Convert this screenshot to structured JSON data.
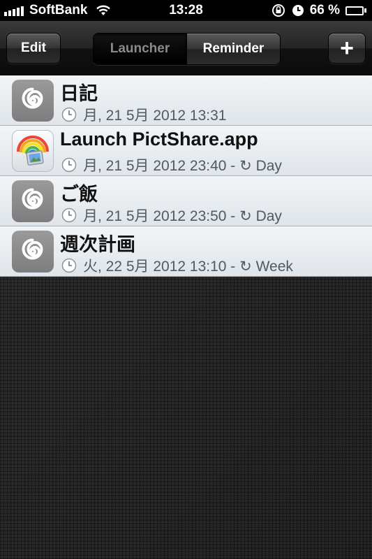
{
  "status_bar": {
    "carrier": "SoftBank",
    "time": "13:28",
    "battery_percent": "66 %",
    "battery_level": 0.66,
    "icons": [
      "signal-bars-icon",
      "wifi-icon",
      "orientation-lock-icon",
      "alarm-clock-icon",
      "battery-icon"
    ]
  },
  "nav": {
    "edit_label": "Edit",
    "add_label": "+",
    "segments": [
      {
        "label": "Launcher",
        "selected": true
      },
      {
        "label": "Reminder",
        "selected": false
      }
    ]
  },
  "items": [
    {
      "title": "日記",
      "subtitle": "月, 21 5月 2012 13:31",
      "icon": "spiral-icon"
    },
    {
      "title": "Launch PictShare.app",
      "subtitle": "月, 21 5月 2012 23:40 - ↻ Day",
      "icon": "pictshare-app-icon"
    },
    {
      "title": "ご飯",
      "subtitle": "月, 21 5月 2012 23:50 - ↻ Day",
      "icon": "spiral-icon"
    },
    {
      "title": "週次計画",
      "subtitle": "火, 22 5月 2012 13:10 - ↻ Week",
      "icon": "spiral-icon"
    }
  ],
  "colors": {
    "nav_background": "#1a1a1a",
    "row_background": "#e6ebef",
    "subtitle_text": "#505a63",
    "icon_gray": "#8a8a8a"
  }
}
